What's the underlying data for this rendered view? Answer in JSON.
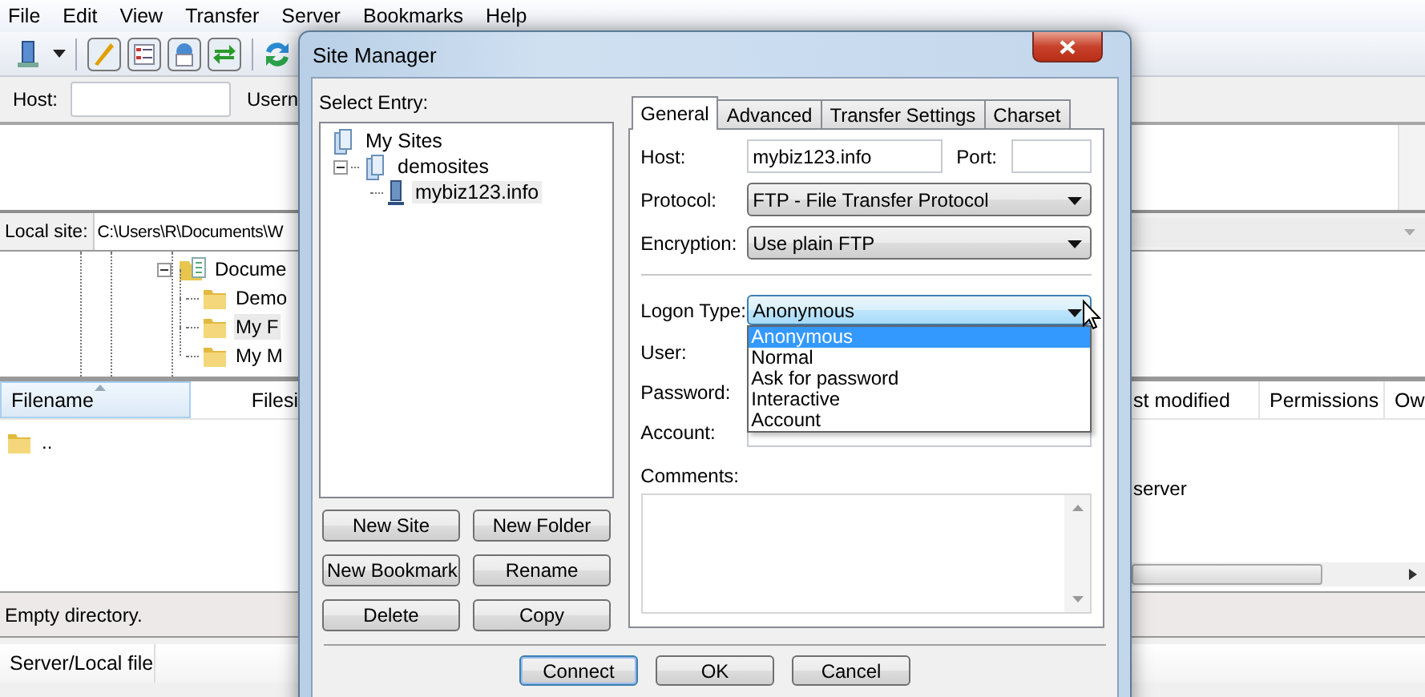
{
  "menu": [
    {
      "label": "File"
    },
    {
      "label": "Edit"
    },
    {
      "label": "View"
    },
    {
      "label": "Transfer"
    },
    {
      "label": "Server"
    },
    {
      "label": "Bookmarks"
    },
    {
      "label": "Help"
    }
  ],
  "quickconnect": {
    "host_label": "Host:",
    "user_label": "Usern"
  },
  "local_site": {
    "label": "Local site:",
    "path": "C:\\Users\\R\\Documents\\W"
  },
  "local_tree": [
    {
      "label": "Docume",
      "expanded": true,
      "children": [
        {
          "label": "Demo",
          "selected": false
        },
        {
          "label": "My F",
          "selected": true
        },
        {
          "label": "My M",
          "selected": false
        }
      ]
    }
  ],
  "file_list": {
    "columns": [
      "Filename",
      "Filesi"
    ],
    "rows": [
      ".."
    ]
  },
  "remote_list": {
    "columns": [
      "st modified",
      "Permissions",
      "Ow"
    ],
    "message": "server"
  },
  "status_bar": "Empty directory.",
  "queue": {
    "columns": [
      "Server/Local file"
    ]
  },
  "dialog": {
    "title": "Site Manager",
    "select_entry_label": "Select Entry:",
    "tree": [
      {
        "label": "My Sites",
        "children": [
          {
            "label": "demosites",
            "expanded": true,
            "children": [
              {
                "label": "mybiz123.info",
                "selected": true
              }
            ]
          }
        ]
      }
    ],
    "buttons": [
      "New Site",
      "New Folder",
      "New Bookmark",
      "Rename",
      "Delete",
      "Copy"
    ],
    "tabs": [
      {
        "label": "General",
        "selected": true
      },
      {
        "label": "Advanced",
        "selected": false
      },
      {
        "label": "Transfer Settings",
        "selected": false
      },
      {
        "label": "Charset",
        "selected": false
      }
    ],
    "host": {
      "label": "Host:",
      "value": "mybiz123.info"
    },
    "port": {
      "label": "Port:"
    },
    "protocol": {
      "label": "Protocol:",
      "value": "FTP - File Transfer Protocol"
    },
    "encryption": {
      "label": "Encryption:",
      "value": "Use plain FTP"
    },
    "logon_type": {
      "label": "Logon Type:",
      "value": "Anonymous",
      "expanded": true,
      "options": [
        {
          "label": "Anonymous",
          "selected": true
        },
        {
          "label": "Normal",
          "selected": false
        },
        {
          "label": "Ask for password",
          "selected": false
        },
        {
          "label": "Interactive",
          "selected": false
        },
        {
          "label": "Account",
          "selected": false
        }
      ]
    },
    "user": {
      "label": "User:"
    },
    "password": {
      "label": "Password:"
    },
    "account": {
      "label": "Account:"
    },
    "comments": {
      "label": "Comments:"
    },
    "footer_buttons": [
      "Connect",
      "OK",
      "Cancel"
    ]
  }
}
